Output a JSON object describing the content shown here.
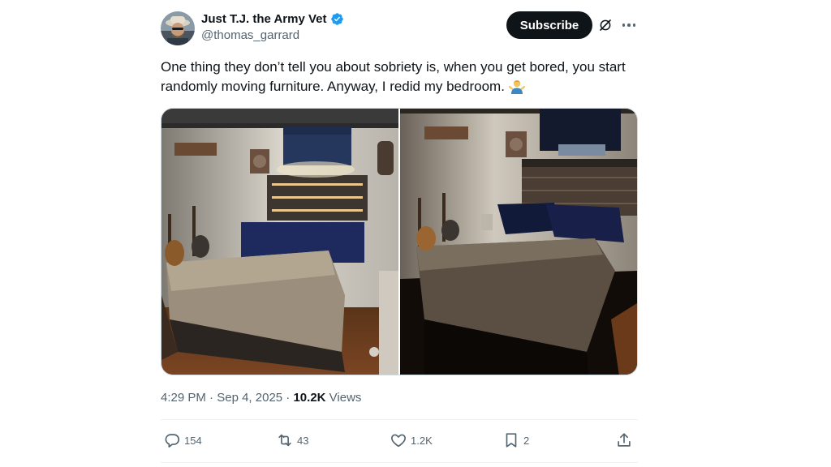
{
  "author": {
    "display_name": "Just T.J. the Army Vet",
    "handle": "@thomas_garrard",
    "verified_icon": "verified-badge-icon",
    "verified_color": "#1d9bf0"
  },
  "header": {
    "subscribe_label": "Subscribe",
    "grok_icon": "grok-icon",
    "more_icon": "more-options-icon"
  },
  "tweet": {
    "text": "One thing they don’t tell you about sobriety is, when you get bored, you start randomly moving furniture. Anyway, I redid my bedroom.",
    "emoji": "person-shrugging-emoji"
  },
  "media": {
    "photos": [
      "bedroom-photo-1",
      "bedroom-photo-2"
    ]
  },
  "meta": {
    "time": "4:29 PM",
    "separator1": " · ",
    "date": "Sep 4, 2025",
    "separator2": " · ",
    "views_count": "10.2K",
    "views_label": " Views"
  },
  "actions": {
    "replies": "154",
    "reposts": "43",
    "likes": "1.2K",
    "bookmarks": "2"
  },
  "colors": {
    "text_primary": "#0f1419",
    "text_secondary": "#536471",
    "subscribe_bg": "#0f1419",
    "divider": "#eff3f4"
  }
}
